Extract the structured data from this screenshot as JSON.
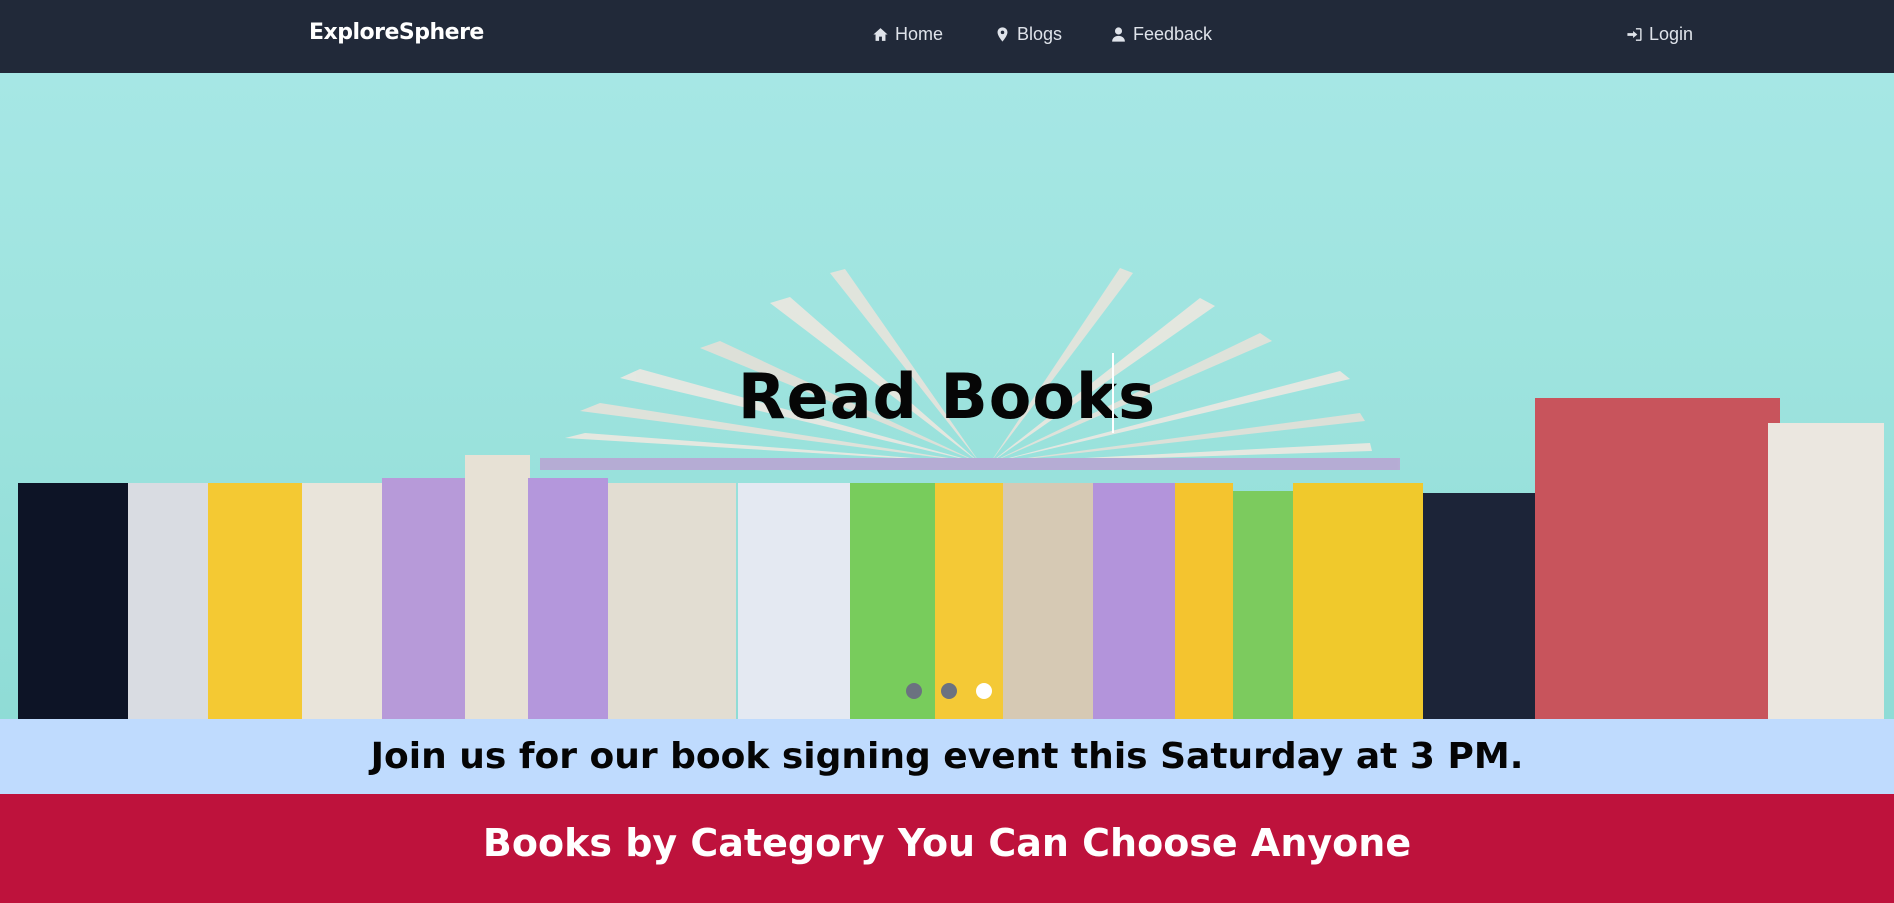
{
  "navbar": {
    "brand": "ExploreSphere",
    "links": [
      {
        "label": "Home",
        "icon": "home-icon"
      },
      {
        "label": "Blogs",
        "icon": "map-pin-icon"
      },
      {
        "label": "Feedback",
        "icon": "user-icon"
      }
    ],
    "login": {
      "label": "Login",
      "icon": "sign-in-icon"
    }
  },
  "hero": {
    "title": "Read Books",
    "slides": 3,
    "active_slide": 3
  },
  "announcement": {
    "text": "Join us for our book signing event this Saturday at 3 PM."
  },
  "category": {
    "title": "Books by Category You Can Choose Anyone"
  },
  "colors": {
    "navbar": "#212939",
    "hero_bg": "#a6e7e5",
    "announcement_bg": "#bfdbfe",
    "category_bg": "#be123c"
  }
}
